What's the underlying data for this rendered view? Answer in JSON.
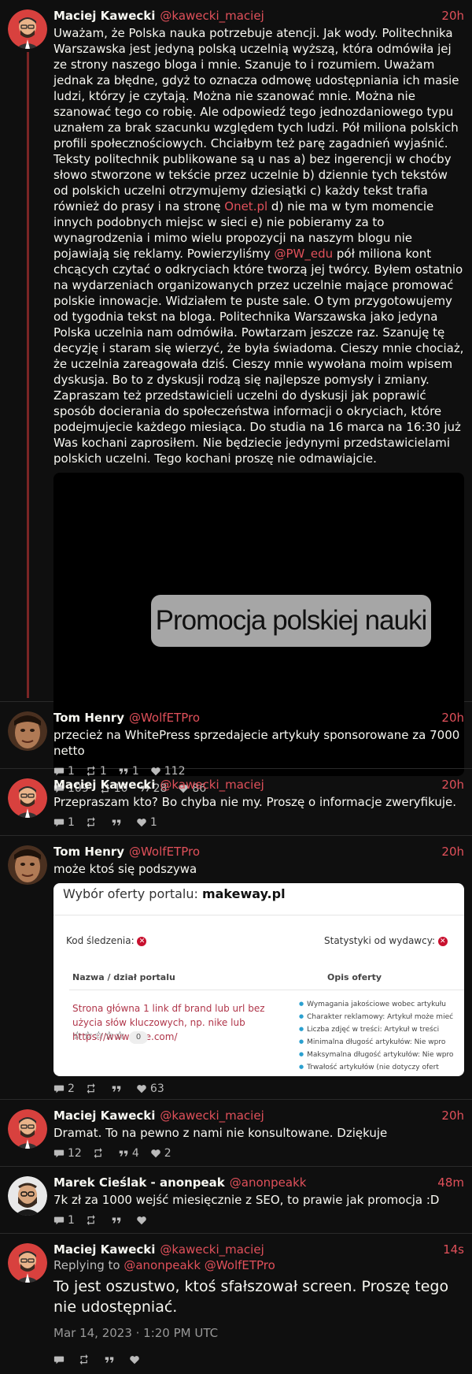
{
  "colors": {
    "background": "#0f0f0f",
    "accent": "#e0505a",
    "thread_line": "#7a2525"
  },
  "tweets": [
    {
      "fullname": "Maciej Kawecki",
      "username": "@kawecki_maciej",
      "date": "20h",
      "text_parts": [
        "Uważam, że Polska nauka potrzebuje atencji. Jak wody. Politechnika Warszawska jest jedyną polską uczelnią wyższą, która odmówiła jej ze strony naszego bloga i mnie. Szanuje to i rozumiem. Uważam jednak za błędne, gdyż to oznacza odmowę udostępniania ich masie ludzi, którzy je czytają. Można nie szanować mnie. Można nie szanować tego co robię. Ale odpowiedź tego jednozdaniowego typu uznałem za brak szacunku względem tych ludzi. Pół miliona polskich profili społecznościowych. Chciałbym też parę zagadnień wyjaśnić. Teksty politechnik publikowane są u nas a) bez ingerencji w choćby słowo stworzone w tekście przez uczelnie b) dziennie tych tekstów od polskich uczelni otrzymujemy dziesiątki c) każdy tekst trafia również do prasy i na stronę ",
        "Onet.pl",
        " d) nie ma w tym momencie innych podobnych miejsc w sieci e) nie pobieramy za to wynagrodzenia i mimo wielu propozycji na naszym blogu nie pojawiają się reklamy. Powierzyliśmy ",
        "@PW_edu",
        " pół miliona kont chcących czytać o odkryciach które tworzą jej twórcy. Byłem ostatnio na wydarzeniach organizowanych przez uczelnie mające promować polskie innowacje. Widziałem te puste sale. O tym przygotowujemy od tygodnia tekst na bloga. Politechnika Warszawska jako jedyna Polska uczelnia nam odmówiła. Powtarzam jeszcze raz. Szanuję tę decyzję i staram się wierzyć, że była świadoma. Cieszy mnie chociaż, że uczelnia zareagowała dziś. Cieszy mnie wywołana moim wpisem dyskusja. Bo to z dyskusji rodzą się najlepsze pomysły i zmiany. Zapraszam też przedstawicieli uczelni do dyskusji jak poprawić sposób docierania do społeczeństwa informacji o okryciach, które podejmujecie każdego miesiąca. Do studia na 16 marca na 16:30 już Was kochani zaprosiłem. Nie będziecie jedynymi przedstawicielami polskich uczelni. Tego kochani proszę nie odmawiajcie."
      ],
      "video_caption": "Promocja polskiej nauki",
      "stats": {
        "comments": "109",
        "retweets": "10",
        "quotes": "28",
        "likes": "86"
      }
    },
    {
      "fullname": "Tom Henry",
      "username": "@WolfETPro",
      "date": "20h",
      "text": "przecież na WhitePress sprzedajecie artykuły sponsorowane za 7000 netto",
      "stats": {
        "comments": "1",
        "retweets": "1",
        "quotes": "1",
        "likes": "112"
      }
    },
    {
      "fullname": "Maciej Kawecki",
      "username": "@kawecki_maciej",
      "date": "20h",
      "text": "Przepraszam kto? Bo chyba nie my. Proszę o informacje zweryfikuje.",
      "stats": {
        "comments": "1",
        "retweets": "",
        "quotes": "",
        "likes": "1"
      }
    },
    {
      "fullname": "Tom Henry",
      "username": "@WolfETPro",
      "date": "20h",
      "text": "może ktoś się podszywa",
      "screenshot": {
        "title_prefix": "Wybór oferty portalu: ",
        "title_domain": "makeway.pl",
        "tracking_label": "Kod śledzenia:",
        "stats_label": "Statystyki od wydawcy:",
        "col1_header": "Nazwa / dział portalu",
        "col2_header": "Opis oferty",
        "offer_text": "Strona główna 1 link df brand lub url bez użycia słów kluczowych, np. nike lub https://www.nike.com/",
        "rating_stars": "☆☆☆☆☆",
        "rating_count": "0",
        "bullets": [
          "Wymagania jakościowe wobec artykułu",
          "Charakter reklamowy: Artykuł może mieć",
          "Liczba zdjęć w treści: Artykuł w treści",
          "Minimalna długość artykułów: Nie wpro",
          "Maksymalna długość artykułów: Nie wpro",
          "Trwałość artykułów (nie dotyczy ofert"
        ]
      },
      "stats": {
        "comments": "2",
        "retweets": "",
        "quotes": "",
        "likes": "63"
      }
    },
    {
      "fullname": "Maciej Kawecki",
      "username": "@kawecki_maciej",
      "date": "20h",
      "text": "Dramat. To na pewno z nami nie konsultowane. Dziękuje",
      "stats": {
        "comments": "12",
        "retweets": "",
        "quotes": "4",
        "likes": "2"
      }
    },
    {
      "fullname": "Marek Cieślak - anonpeak",
      "username": "@anonpeakk",
      "date": "48m",
      "text": "7k zł za 1000 wejść miesięcznie z SEO, to prawie jak promocja :D",
      "stats": {
        "comments": "1",
        "retweets": "",
        "quotes": "",
        "likes": ""
      }
    },
    {
      "fullname": "Maciej Kawecki",
      "username": "@kawecki_maciej",
      "date": "14s",
      "replying_prefix": "Replying to ",
      "replying_to": "@anonpeakk @WolfETPro",
      "text": "To jest oszustwo, ktoś sfałszował screen. Proszę tego nie udostępniać.",
      "timestamp": "Mar 14, 2023 · 1:20 PM UTC",
      "stats": {
        "comments": "",
        "retweets": "",
        "quotes": "",
        "likes": ""
      }
    }
  ]
}
